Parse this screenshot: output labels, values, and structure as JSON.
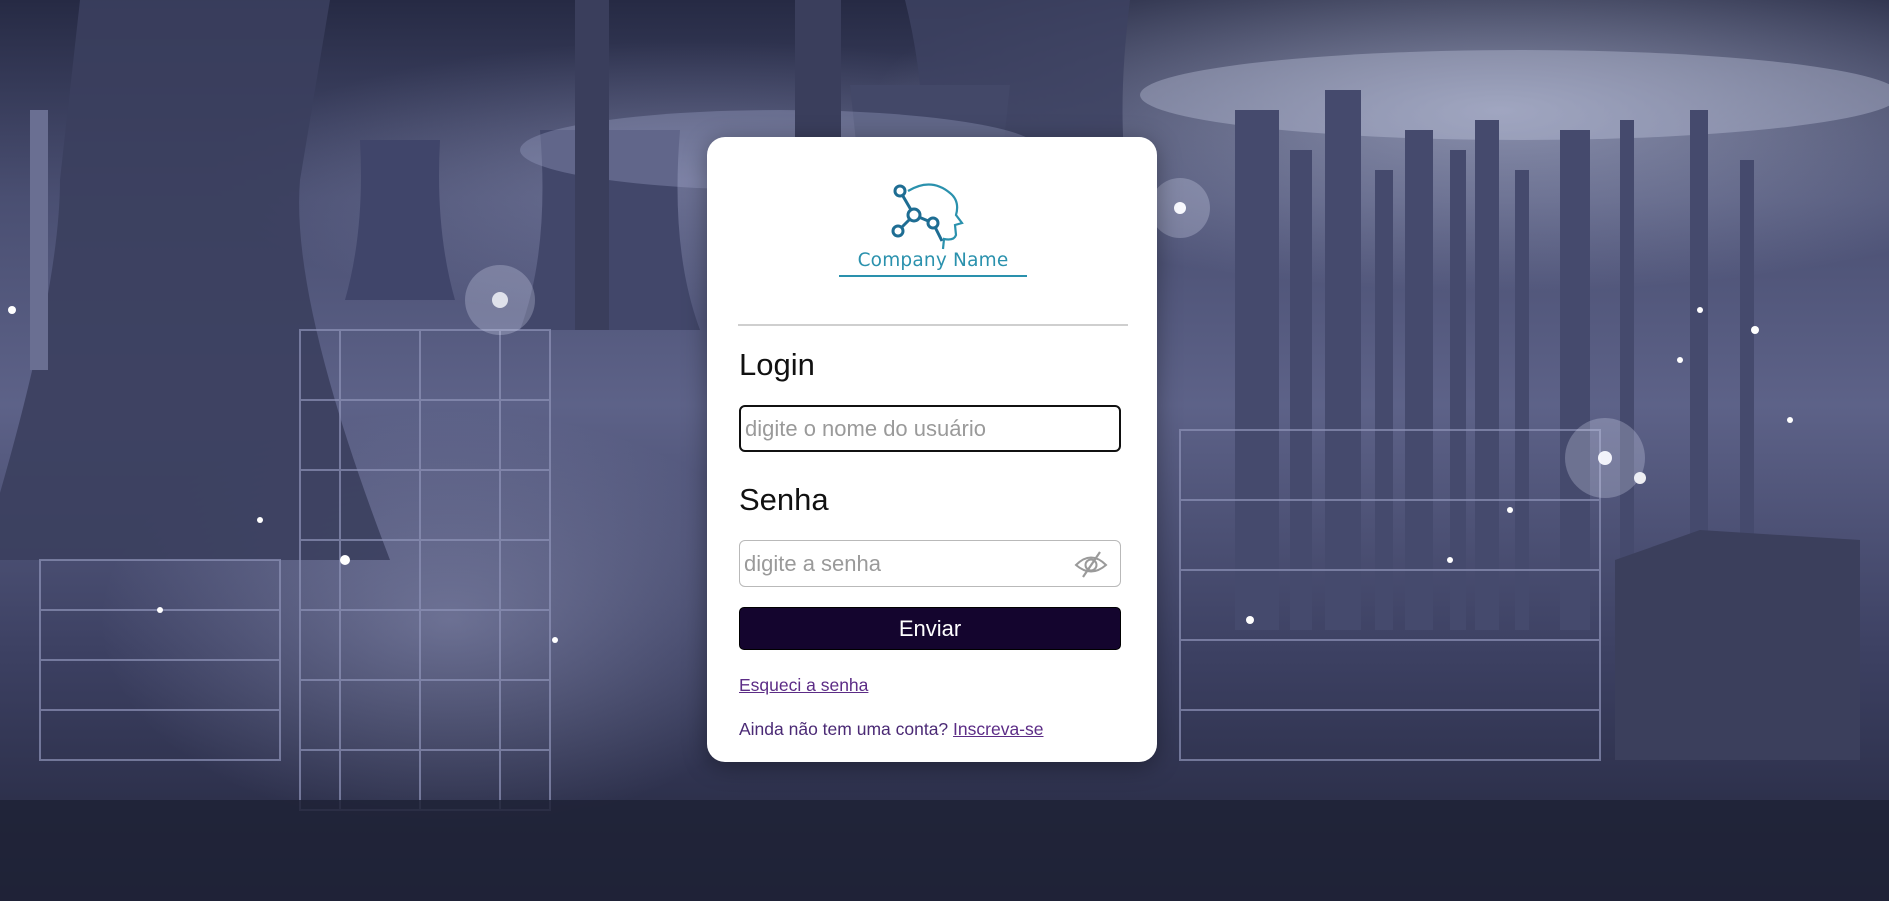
{
  "company": {
    "name": "Company Name",
    "brand_color": "#2a91ad"
  },
  "login": {
    "label": "Login",
    "username_placeholder": "digite o nome do usuário",
    "username_value": ""
  },
  "password": {
    "label": "Senha",
    "placeholder": "digite a senha",
    "value": "",
    "toggle_icon": "eye-slash-icon"
  },
  "submit_label": "Enviar",
  "links": {
    "forgot_password": "Esqueci a senha",
    "signup_prompt": "Ainda não tem uma conta?",
    "signup": "Inscreva-se"
  },
  "colors": {
    "button_bg": "#14052e",
    "link": "#5c2c86",
    "background_tint": "#4a4f72"
  }
}
